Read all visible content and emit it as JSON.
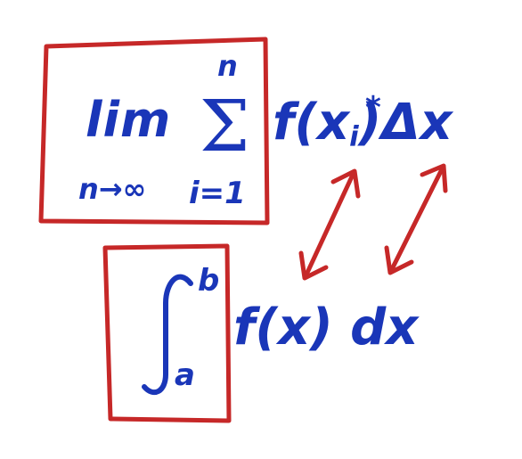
{
  "riemann_sum": {
    "lim": "lim",
    "lim_subscript": "n→∞",
    "sum_upper": "n",
    "sum_symbol": "Σ",
    "sum_lower": "i=1",
    "body_prefix": "f(x",
    "body_index": "i",
    "body_star": "*",
    "body_suffix": ")Δx"
  },
  "integral": {
    "upper_limit": "b",
    "lower_limit": "a",
    "integrand": "f(x) dx"
  },
  "colors": {
    "ink": "#1a36b8",
    "box": "#c62828",
    "arrow": "#c62828"
  }
}
